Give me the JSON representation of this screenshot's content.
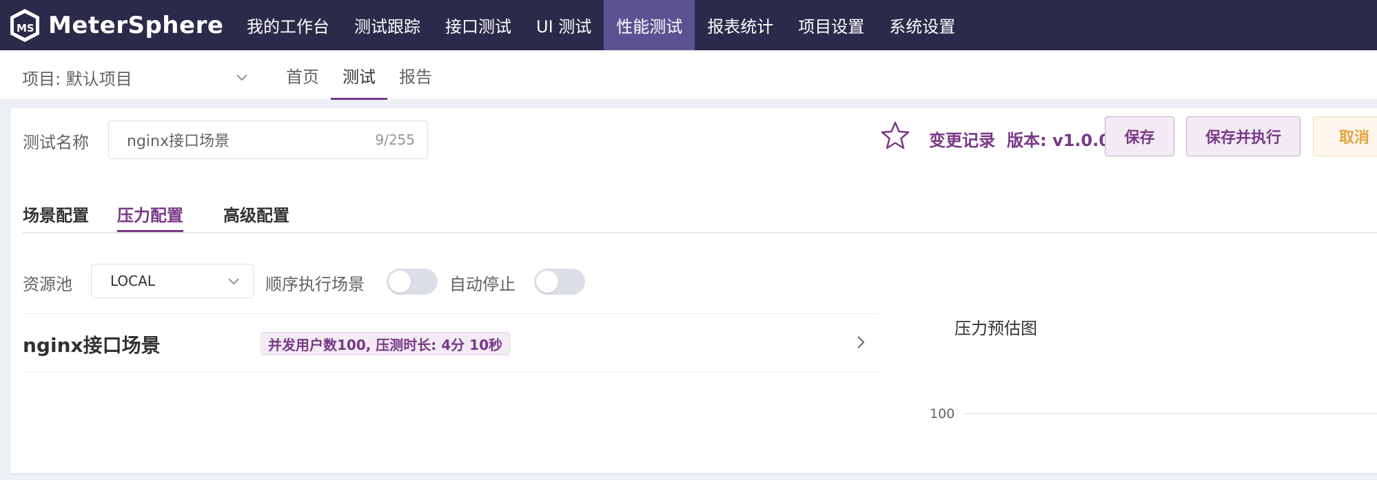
{
  "topnav": {
    "logo_text": "MeterSphere",
    "items": [
      "我的工作台",
      "测试跟踪",
      "接口测试",
      "UI 测试",
      "性能测试",
      "报表统计",
      "项目设置",
      "系统设置"
    ],
    "active_index": 4
  },
  "subnav": {
    "project_label": "项目: 默认项目",
    "tabs": [
      "首页",
      "测试",
      "报告"
    ],
    "active_index": 1
  },
  "form": {
    "name_label": "测试名称",
    "name_value": "nginx接口场景",
    "name_count": "9/255",
    "change_log": "变更记录",
    "version": "版本: v1.0.0",
    "save_label": "保存",
    "save_run_label": "保存并执行",
    "cancel_label": "取消"
  },
  "config_tabs": {
    "items": [
      "场景配置",
      "压力配置",
      "高级配置"
    ],
    "active_index": 1
  },
  "pressure": {
    "pool_label": "资源池",
    "pool_value": "LOCAL",
    "sequential_label": "顺序执行场景",
    "sequential_on": false,
    "auto_stop_label": "自动停止",
    "auto_stop_on": false
  },
  "scenario": {
    "name": "nginx接口场景",
    "summary": "并发用户数100, 压测时长: 4分 10秒"
  },
  "chart_data": {
    "type": "line",
    "title": "压力预估图",
    "y_tick_labels": [
      "100"
    ],
    "grid": true
  },
  "colors": {
    "nav_bg": "#2b2a4a",
    "nav_active": "#5b5391",
    "accent": "#783887",
    "warning": "#e6a23c"
  }
}
